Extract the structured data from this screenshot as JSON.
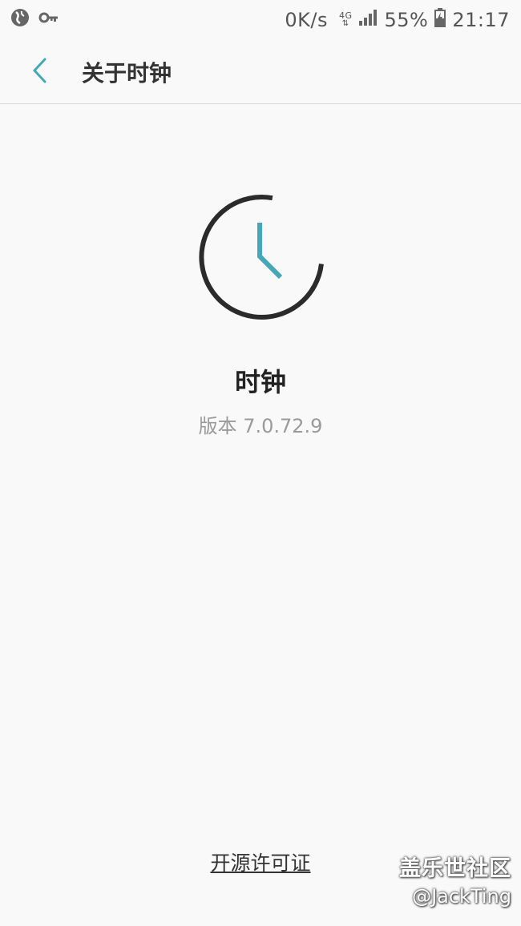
{
  "status_bar": {
    "network_speed": "0K/s",
    "network_type": "4G",
    "battery": "55%",
    "time": "21:17",
    "left_icons": [
      "vpn-globe-icon",
      "key-icon"
    ]
  },
  "app_bar": {
    "back_icon": "chevron-left-icon",
    "title": "关于时钟"
  },
  "about": {
    "logo_icon": "clock-icon",
    "app_name": "时钟",
    "version": "版本 7.0.72.9"
  },
  "footer": {
    "license_link": "开源许可证"
  },
  "watermark": {
    "title": "盖乐世社区",
    "user": "@JackTing"
  },
  "colors": {
    "accent": "#45a7b7",
    "background": "#f9f9f9",
    "clock_ring": "#2b2b2b"
  }
}
